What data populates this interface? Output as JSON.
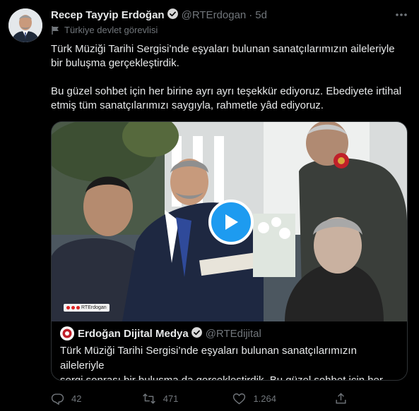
{
  "tweet": {
    "author_name": "Recep Tayyip Erdoğan",
    "handle": "@RTErdogan",
    "separator": "·",
    "time": "5d",
    "affiliation": "Türkiye devlet görevlisi",
    "paragraphs": [
      "Türk Müziği Tarihi Sergisi’nde eşyaları bulunan sanatçılarımızın aileleriyle bir buluşma gerçekleştirdik.",
      "Bu güzel sohbet için her birine ayrı ayrı teşekkür ediyoruz. Ebediyete irtihal etmiş tüm sanatçılarımızı saygıyla, rahmetle yâd ediyoruz."
    ]
  },
  "quoted": {
    "author_name": "Erdoğan Dijital Medya",
    "handle": "@RTEdijital",
    "text_line1": "Türk Müziği Tarihi Sergisi’nde eşyaları bulunan sanatçılarımızın aileleriyle",
    "text_line2": "sergi sonrası bir buluşma da gerçekleştirdik.   Bu güzel sohbet için her ...",
    "video_watermark": "RTErdogan"
  },
  "actions": {
    "replies": "42",
    "retweets": "471",
    "likes": "1.264"
  },
  "colors": {
    "background": "#000000",
    "text": "#e7e9ea",
    "muted": "#71767b",
    "accent": "#1d9bf0",
    "border": "#2f3336"
  },
  "icons": [
    "verified-badge-icon",
    "more-icon",
    "government-flag-icon",
    "play-icon",
    "reply-icon",
    "retweet-icon",
    "like-icon",
    "share-icon"
  ]
}
